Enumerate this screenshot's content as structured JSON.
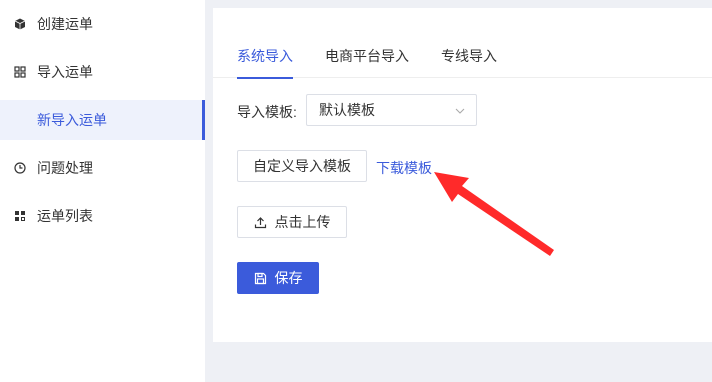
{
  "sidebar": {
    "items": [
      {
        "label": "创建运单",
        "icon": "cube-icon"
      },
      {
        "label": "导入运单",
        "icon": "grid-icon"
      },
      {
        "label": "新导入运单",
        "icon": ""
      },
      {
        "label": "问题处理",
        "icon": "clock-icon"
      },
      {
        "label": "运单列表",
        "icon": "list-grid-icon"
      }
    ]
  },
  "tabs": [
    {
      "label": "系统导入",
      "active": true
    },
    {
      "label": "电商平台导入",
      "active": false
    },
    {
      "label": "专线导入",
      "active": false
    }
  ],
  "form": {
    "template_label": "导入模板:",
    "template_value": "默认模板",
    "custom_template_button": "自定义导入模板",
    "download_link": "下载模板",
    "upload_button": "点击上传",
    "save_button": "保存"
  },
  "colors": {
    "accent": "#3b5bdb",
    "annotation_arrow": "#ff2a2a",
    "background": "#eef0f5"
  }
}
